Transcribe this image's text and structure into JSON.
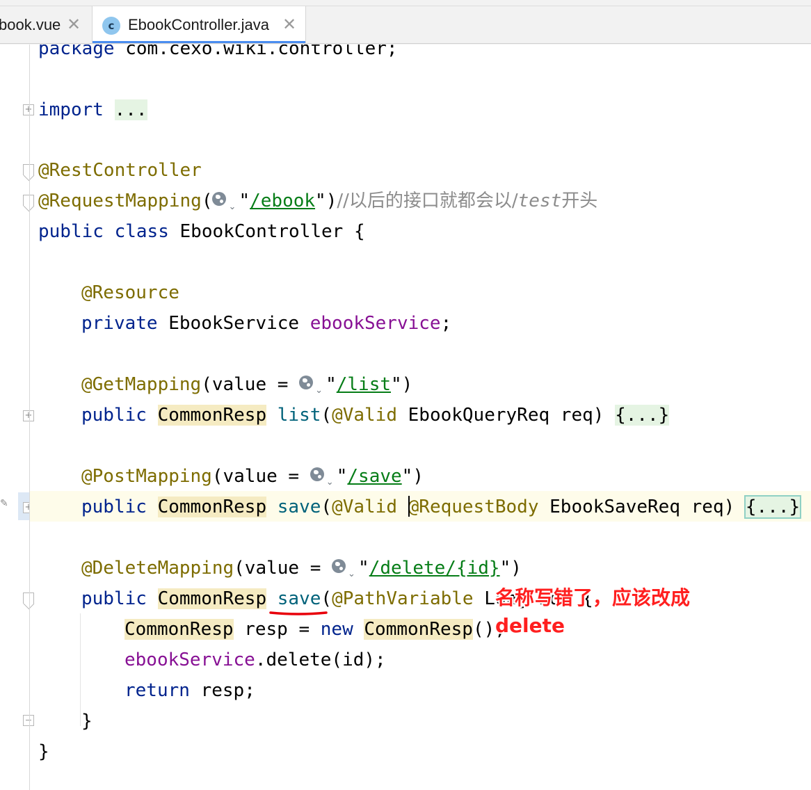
{
  "tabs": [
    {
      "label": "book.vue",
      "close": "✕"
    },
    {
      "label": "EbookController.java",
      "icon_letter": "c",
      "close": "✕",
      "active": true
    }
  ],
  "code": {
    "package_kw": "package",
    "package_name": " com.cexo.wiki.controller;",
    "import_kw": "import",
    "import_fold": "...",
    "rest_ann": "@RestController",
    "reqmap_ann": "@RequestMapping",
    "reqmap_url": "/ebook",
    "reqmap_comment": "//以后的接口就都会以/",
    "reqmap_comment_italic": "test",
    "reqmap_comment_end": "开头",
    "class_kw1": "public",
    "class_kw2": "class",
    "class_name": " EbookController {",
    "resource_ann": "@Resource",
    "private_kw": "private",
    "service_type": " EbookService ",
    "service_field": "ebookService",
    "semicolon": ";",
    "get_ann": "@GetMapping",
    "value_eq": "(value = ",
    "get_url": "/list",
    "public_kw": "public",
    "resp_type": "CommonResp",
    "list_method": "list",
    "valid_ann": "@Valid",
    "list_params": " EbookQueryReq req) ",
    "fold_body": "{...}",
    "post_ann": "@PostMapping",
    "post_url": "/save",
    "save_method": "save",
    "reqbody_ann": "@RequestBody",
    "save_params": " EbookSaveReq req) ",
    "delete_ann": "@DeleteMapping",
    "delete_url_a": "/delete/",
    "delete_url_b": "{id}",
    "pathvar_ann": "@PathVariable",
    "delete_params": " Long id) {",
    "resp_decl_a": " resp = ",
    "new_kw": "new",
    "resp_ctor_end": "();",
    "delete_call": ".delete(id);",
    "return_kw": "return",
    "return_rest": " resp;",
    "close_brace": "}"
  },
  "annotation_note": {
    "line1": "名称写错了，应该改成",
    "line2": "delete"
  },
  "colors": {
    "keyword": "#00238d",
    "annotation": "#7d6c00",
    "string": "#067d17",
    "field": "#871094",
    "note": "#ff1f1f"
  }
}
